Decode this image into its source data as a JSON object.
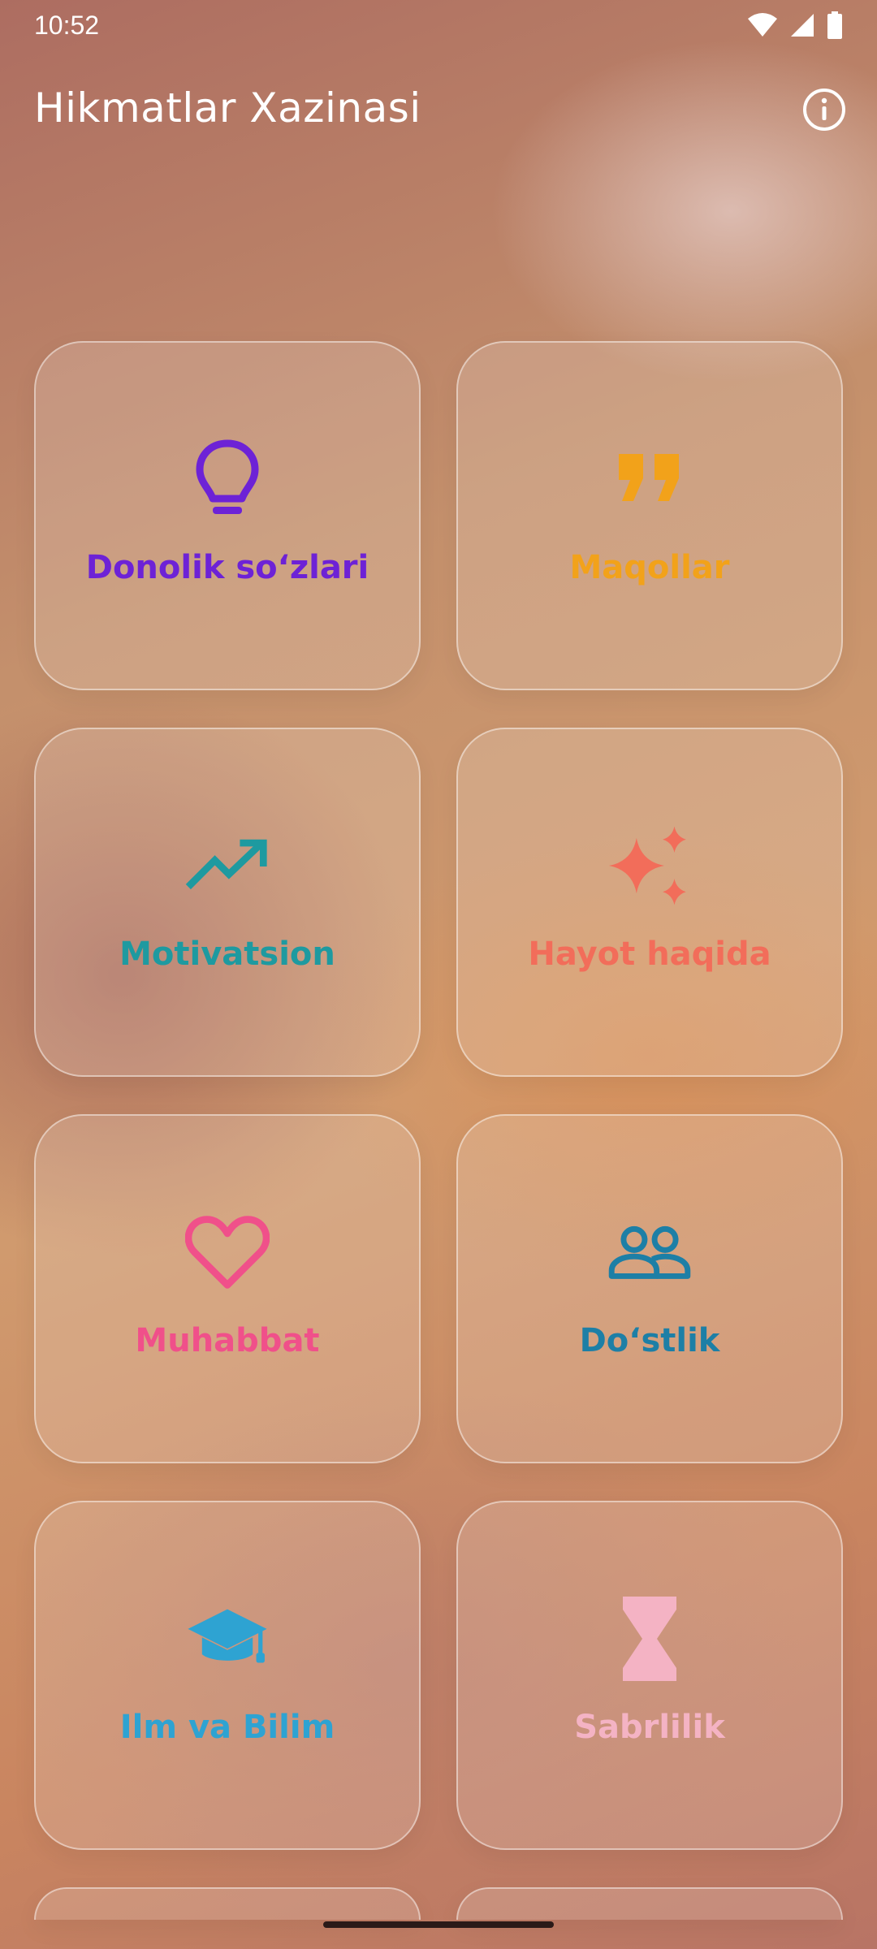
{
  "status": {
    "time": "10:52"
  },
  "app": {
    "title": "Hikmatlar Xazinasi"
  },
  "icons": {
    "info": "info-icon",
    "wifi": "wifi-icon",
    "signal": "signal-icon",
    "battery": "battery-icon"
  },
  "categories": [
    {
      "label": "Donolik so‘zlari",
      "icon": "lightbulb-icon",
      "color": "#6d22d6"
    },
    {
      "label": "Maqollar",
      "icon": "quote-icon",
      "color": "#f2a21a"
    },
    {
      "label": "Motivatsion",
      "icon": "trending-up-icon",
      "color": "#1e9aa0"
    },
    {
      "label": "Hayot haqida",
      "icon": "sparkles-icon",
      "color": "#f26d5a"
    },
    {
      "label": "Muhabbat",
      "icon": "heart-icon",
      "color": "#f0508a"
    },
    {
      "label": "Do‘stlik",
      "icon": "people-icon",
      "color": "#1d7fa6"
    },
    {
      "label": "Ilm va Bilim",
      "icon": "graduation-cap-icon",
      "color": "#2ea3d2"
    },
    {
      "label": "Sabrlilik",
      "icon": "hourglass-icon",
      "color": "#f4b3c4"
    }
  ]
}
